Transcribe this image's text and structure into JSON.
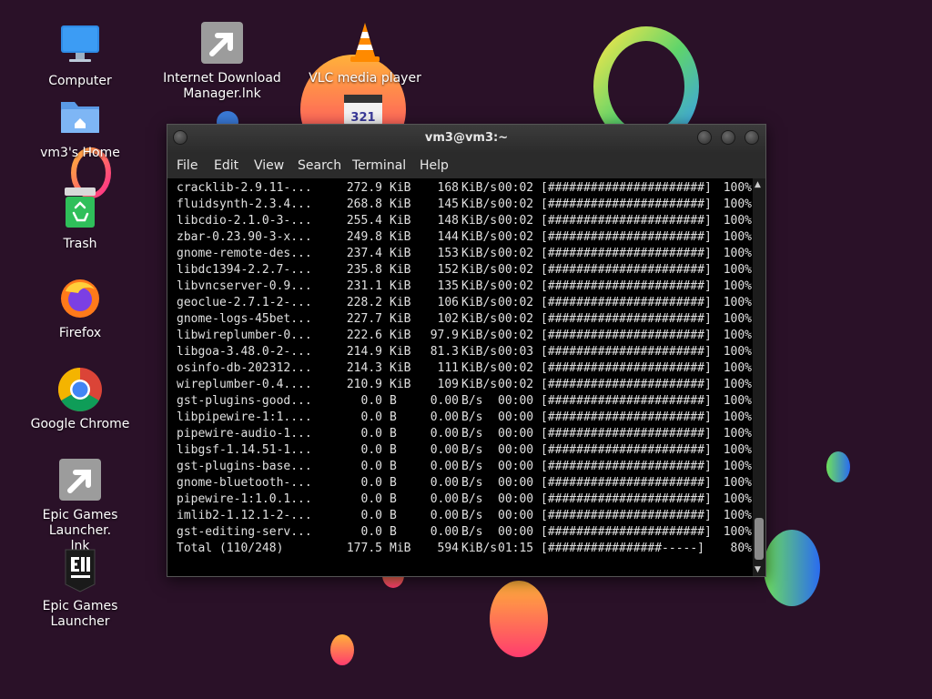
{
  "desktop": {
    "icons": [
      {
        "label": "Computer",
        "icon": "monitor-icon"
      },
      {
        "label": "Internet Download Manager.lnk",
        "icon": "shortcut-icon"
      },
      {
        "label": "VLC media player",
        "icon": "vlc-cone-icon"
      },
      {
        "label": "vm3's Home",
        "icon": "home-folder-icon"
      },
      {
        "label": "Trash",
        "icon": "trash-icon"
      },
      {
        "label": "Firefox",
        "icon": "firefox-icon"
      },
      {
        "label": "Google Chrome",
        "icon": "chrome-icon"
      },
      {
        "label": "Epic Games Launcher.\nlnk",
        "icon": "shortcut-icon"
      },
      {
        "label": "Epic Games Launcher",
        "icon": "epic-games-icon"
      }
    ],
    "partial_icon_text": "321"
  },
  "terminal": {
    "title": "vm3@vm3:~",
    "menu": [
      "File",
      "Edit",
      "View",
      "Search",
      "Terminal",
      "Help"
    ],
    "rows": [
      {
        "name": "cracklib-2.9.11-...",
        "size": "272.9",
        "unit": "KiB",
        "rate": "168",
        "rate_unit": "KiB/s",
        "time": "00:02",
        "bar": "[######################]",
        "pct": "100%"
      },
      {
        "name": "fluidsynth-2.3.4...",
        "size": "268.8",
        "unit": "KiB",
        "rate": "145",
        "rate_unit": "KiB/s",
        "time": "00:02",
        "bar": "[######################]",
        "pct": "100%"
      },
      {
        "name": "libcdio-2.1.0-3-...",
        "size": "255.4",
        "unit": "KiB",
        "rate": "148",
        "rate_unit": "KiB/s",
        "time": "00:02",
        "bar": "[######################]",
        "pct": "100%"
      },
      {
        "name": "zbar-0.23.90-3-x...",
        "size": "249.8",
        "unit": "KiB",
        "rate": "144",
        "rate_unit": "KiB/s",
        "time": "00:02",
        "bar": "[######################]",
        "pct": "100%"
      },
      {
        "name": "gnome-remote-des...",
        "size": "237.4",
        "unit": "KiB",
        "rate": "153",
        "rate_unit": "KiB/s",
        "time": "00:02",
        "bar": "[######################]",
        "pct": "100%"
      },
      {
        "name": "libdc1394-2.2.7-...",
        "size": "235.8",
        "unit": "KiB",
        "rate": "152",
        "rate_unit": "KiB/s",
        "time": "00:02",
        "bar": "[######################]",
        "pct": "100%"
      },
      {
        "name": "libvncserver-0.9...",
        "size": "231.1",
        "unit": "KiB",
        "rate": "135",
        "rate_unit": "KiB/s",
        "time": "00:02",
        "bar": "[######################]",
        "pct": "100%"
      },
      {
        "name": "geoclue-2.7.1-2-...",
        "size": "228.2",
        "unit": "KiB",
        "rate": "106",
        "rate_unit": "KiB/s",
        "time": "00:02",
        "bar": "[######################]",
        "pct": "100%"
      },
      {
        "name": "gnome-logs-45bet...",
        "size": "227.7",
        "unit": "KiB",
        "rate": "102",
        "rate_unit": "KiB/s",
        "time": "00:02",
        "bar": "[######################]",
        "pct": "100%"
      },
      {
        "name": "libwireplumber-0...",
        "size": "222.6",
        "unit": "KiB",
        "rate": "97.9",
        "rate_unit": "KiB/s",
        "time": "00:02",
        "bar": "[######################]",
        "pct": "100%"
      },
      {
        "name": "libgoa-3.48.0-2-...",
        "size": "214.9",
        "unit": "KiB",
        "rate": "81.3",
        "rate_unit": "KiB/s",
        "time": "00:03",
        "bar": "[######################]",
        "pct": "100%"
      },
      {
        "name": "osinfo-db-202312...",
        "size": "214.3",
        "unit": "KiB",
        "rate": "111",
        "rate_unit": "KiB/s",
        "time": "00:02",
        "bar": "[######################]",
        "pct": "100%"
      },
      {
        "name": "wireplumber-0.4....",
        "size": "210.9",
        "unit": "KiB",
        "rate": "109",
        "rate_unit": "KiB/s",
        "time": "00:02",
        "bar": "[######################]",
        "pct": "100%"
      },
      {
        "name": "gst-plugins-good...",
        "size": "0.0",
        "unit": "B",
        "rate": "0.00",
        "rate_unit": "B/s",
        "time": "00:00",
        "bar": "[######################]",
        "pct": "100%"
      },
      {
        "name": "libpipewire-1:1....",
        "size": "0.0",
        "unit": "B",
        "rate": "0.00",
        "rate_unit": "B/s",
        "time": "00:00",
        "bar": "[######################]",
        "pct": "100%"
      },
      {
        "name": "pipewire-audio-1...",
        "size": "0.0",
        "unit": "B",
        "rate": "0.00",
        "rate_unit": "B/s",
        "time": "00:00",
        "bar": "[######################]",
        "pct": "100%"
      },
      {
        "name": "libgsf-1.14.51-1...",
        "size": "0.0",
        "unit": "B",
        "rate": "0.00",
        "rate_unit": "B/s",
        "time": "00:00",
        "bar": "[######################]",
        "pct": "100%"
      },
      {
        "name": "gst-plugins-base...",
        "size": "0.0",
        "unit": "B",
        "rate": "0.00",
        "rate_unit": "B/s",
        "time": "00:00",
        "bar": "[######################]",
        "pct": "100%"
      },
      {
        "name": "gnome-bluetooth-...",
        "size": "0.0",
        "unit": "B",
        "rate": "0.00",
        "rate_unit": "B/s",
        "time": "00:00",
        "bar": "[######################]",
        "pct": "100%"
      },
      {
        "name": "pipewire-1:1.0.1...",
        "size": "0.0",
        "unit": "B",
        "rate": "0.00",
        "rate_unit": "B/s",
        "time": "00:00",
        "bar": "[######################]",
        "pct": "100%"
      },
      {
        "name": "imlib2-1.12.1-2-...",
        "size": "0.0",
        "unit": "B",
        "rate": "0.00",
        "rate_unit": "B/s",
        "time": "00:00",
        "bar": "[######################]",
        "pct": "100%"
      },
      {
        "name": "gst-editing-serv...",
        "size": "0.0",
        "unit": "B",
        "rate": "0.00",
        "rate_unit": "B/s",
        "time": "00:00",
        "bar": "[######################]",
        "pct": "100%"
      }
    ],
    "total": {
      "name": "Total (110/248)",
      "size": "177.5",
      "unit": "MiB",
      "rate": "594",
      "rate_unit": "KiB/s",
      "time": "01:15",
      "bar": "[################-----]",
      "pct": "80%"
    }
  },
  "colors": {
    "desktop_background": "#2a1128",
    "terminal_background": "#000000",
    "terminal_text": "#e0e0e0"
  }
}
